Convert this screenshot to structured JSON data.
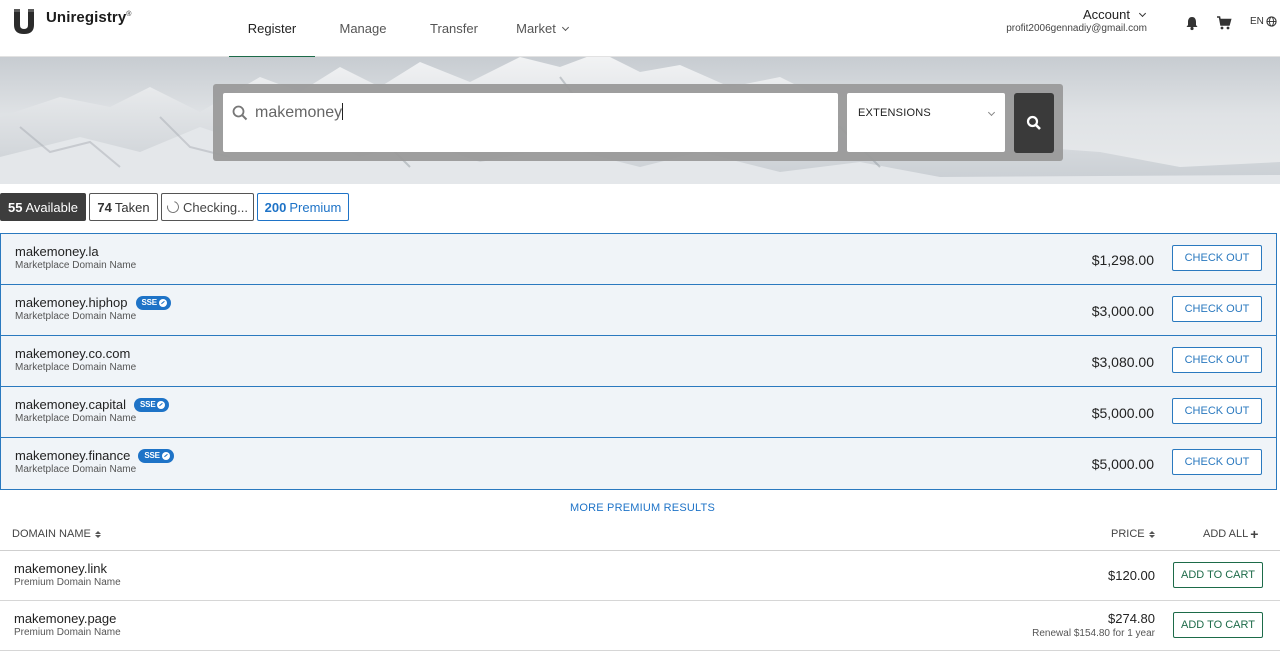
{
  "header": {
    "logo_text": "Uniregistry",
    "logo_mark": "®",
    "nav": {
      "register": "Register",
      "manage": "Manage",
      "transfer": "Transfer",
      "market": "Market"
    },
    "account_label": "Account",
    "account_email": "profit2006gennadiy@gmail.com",
    "lang": "EN"
  },
  "search": {
    "query": "makemoney",
    "extensions_label": "EXTENSIONS"
  },
  "filters": {
    "available_count": "55",
    "available_label": "Available",
    "taken_count": "74",
    "taken_label": "Taken",
    "checking_label": "Checking...",
    "premium_count": "200",
    "premium_label": "Premium"
  },
  "premium_results": [
    {
      "domain": "makemoney.la",
      "type": "Marketplace Domain Name",
      "price": "$1,298.00",
      "sse": "",
      "button": "CHECK OUT"
    },
    {
      "domain": "makemoney.hiphop",
      "type": "Marketplace Domain Name",
      "price": "$3,000.00",
      "sse": "SSE",
      "button": "CHECK OUT"
    },
    {
      "domain": "makemoney.co.com",
      "type": "Marketplace Domain Name",
      "price": "$3,080.00",
      "sse": "",
      "button": "CHECK OUT"
    },
    {
      "domain": "makemoney.capital",
      "type": "Marketplace Domain Name",
      "price": "$5,000.00",
      "sse": "SSE",
      "button": "CHECK OUT"
    },
    {
      "domain": "makemoney.finance",
      "type": "Marketplace Domain Name",
      "price": "$5,000.00",
      "sse": "SSE",
      "button": "CHECK OUT"
    }
  ],
  "more_premium_label": "MORE PREMIUM RESULTS",
  "table": {
    "col_domain": "DOMAIN NAME",
    "col_price": "PRICE",
    "col_add_all": "ADD ALL",
    "rows": [
      {
        "domain": "makemoney.link",
        "type": "Premium Domain Name",
        "price": "$120.00",
        "renewal": "",
        "button": "ADD TO CART"
      },
      {
        "domain": "makemoney.page",
        "type": "Premium Domain Name",
        "price": "$274.80",
        "renewal": "Renewal $154.80 for 1 year",
        "button": "ADD TO CART"
      }
    ]
  },
  "colors": {
    "accent_blue": "#1e73c7",
    "accent_green": "#1d6b49",
    "dark": "#3d3d3d"
  }
}
